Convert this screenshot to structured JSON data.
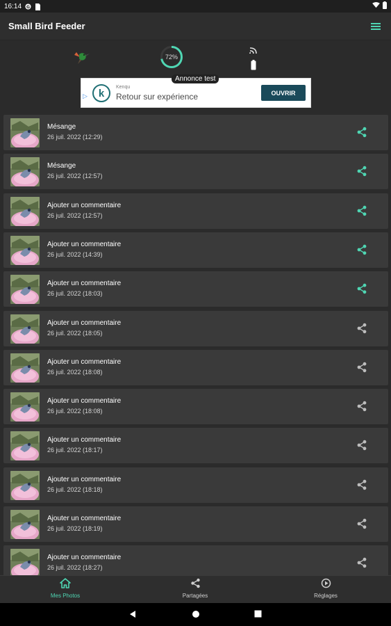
{
  "status_bar": {
    "time": "16:14"
  },
  "app": {
    "title": "Small Bird Feeder"
  },
  "device": {
    "battery_percent": 72,
    "battery_text": "72%"
  },
  "ad": {
    "label": "Annonce test",
    "brand": "Kenqu",
    "text": "Retour sur expérience",
    "cta": "OUVRIR"
  },
  "photos": [
    {
      "title": "Mésange",
      "date": "26 juil. 2022 (12:29)",
      "shared": true
    },
    {
      "title": "Mésange",
      "date": "26 juil. 2022 (12:57)",
      "shared": true
    },
    {
      "title": "Ajouter un commentaire",
      "date": "26 juil. 2022 (12:57)",
      "shared": true
    },
    {
      "title": "Ajouter un commentaire",
      "date": "26 juil. 2022 (14:39)",
      "shared": true
    },
    {
      "title": "Ajouter un commentaire",
      "date": "26 juil. 2022 (18:03)",
      "shared": true
    },
    {
      "title": "Ajouter un commentaire",
      "date": "26 juil. 2022 (18:05)",
      "shared": false
    },
    {
      "title": "Ajouter un commentaire",
      "date": "26 juil. 2022 (18:08)",
      "shared": false
    },
    {
      "title": "Ajouter un commentaire",
      "date": "26 juil. 2022 (18:08)",
      "shared": false
    },
    {
      "title": "Ajouter un commentaire",
      "date": "26 juil. 2022 (18:17)",
      "shared": false
    },
    {
      "title": "Ajouter un commentaire",
      "date": "26 juil. 2022 (18:18)",
      "shared": false
    },
    {
      "title": "Ajouter un commentaire",
      "date": "26 juil. 2022 (18:19)",
      "shared": false
    },
    {
      "title": "Ajouter un commentaire",
      "date": "26 juil. 2022 (18:27)",
      "shared": false
    }
  ],
  "bottom_nav": {
    "items": [
      {
        "label": "Mes Photos",
        "icon": "home-icon",
        "active": true
      },
      {
        "label": "Partagées",
        "icon": "share-icon",
        "active": false
      },
      {
        "label": "Réglages",
        "icon": "settings-icon",
        "active": false
      }
    ]
  },
  "colors": {
    "accent": "#4fd6b3",
    "background": "#2b2b2b",
    "card": "#3a3a3a",
    "inactive_icon": "#bdbdbd"
  },
  "icons": {
    "menu": "hamburger-icon",
    "bird": "hummingbird-icon",
    "signal": "wifi-signal-icon",
    "battery": "battery-icon",
    "share": "share-icon"
  }
}
